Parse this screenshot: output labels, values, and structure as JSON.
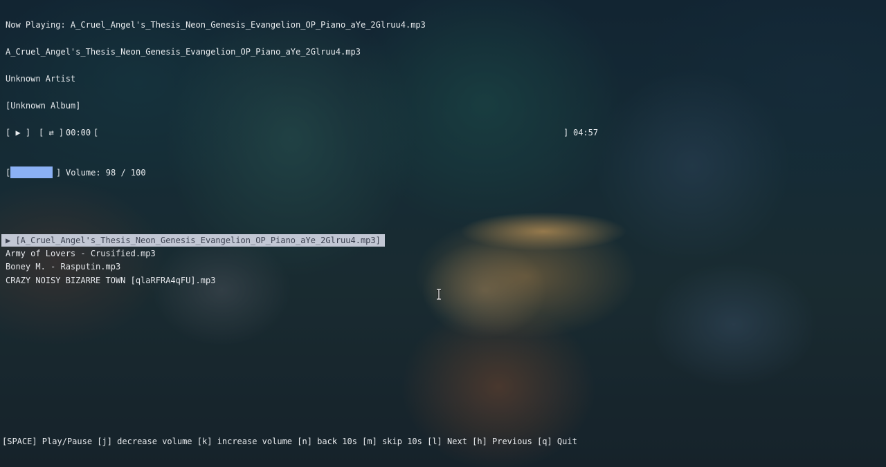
{
  "now_playing": {
    "label": "Now Playing: A_Cruel_Angel's_Thesis_Neon_Genesis_Evangelion_OP_Piano_aYe_2Glruu4.mp3",
    "title": "A_Cruel_Angel's_Thesis_Neon_Genesis_Evangelion_OP_Piano_aYe_2Glruu4.mp3",
    "artist": "Unknown Artist",
    "album": "[Unknown Album]"
  },
  "transport": {
    "play_button": "[ ▶ ]",
    "repeat_button": "[ ⇄ ]",
    "elapsed": "00:00",
    "progress_open": "[",
    "progress_close": "]",
    "duration": "04:57",
    "progress_fraction": 0.0
  },
  "volume": {
    "bar_open": "[",
    "bar_close": "]",
    "label": "Volume: 98 / 100",
    "level": 98,
    "max": 100,
    "fill_color": "#8bb1f5"
  },
  "playlist": {
    "items": [
      {
        "text": "▶ [A_Cruel_Angel's_Thesis_Neon_Genesis_Evangelion_OP_Piano_aYe_2Glruu4.mp3]",
        "selected": true
      },
      {
        "text": "Army of Lovers - Crusified.mp3",
        "selected": false
      },
      {
        "text": "Boney M. - Rasputin.mp3",
        "selected": false
      },
      {
        "text": "CRAZY NOISY BIZARRE TOWN [qlaRFRA4qFU].mp3",
        "selected": false
      }
    ],
    "selected_bg": "#c2c7d4"
  },
  "help_bar": {
    "text": "[SPACE] Play/Pause [j] decrease volume [k] increase volume [n] back 10s [m] skip 10s [l] Next [h] Previous [q] Quit"
  },
  "cursor_icon": "text-cursor-icon"
}
